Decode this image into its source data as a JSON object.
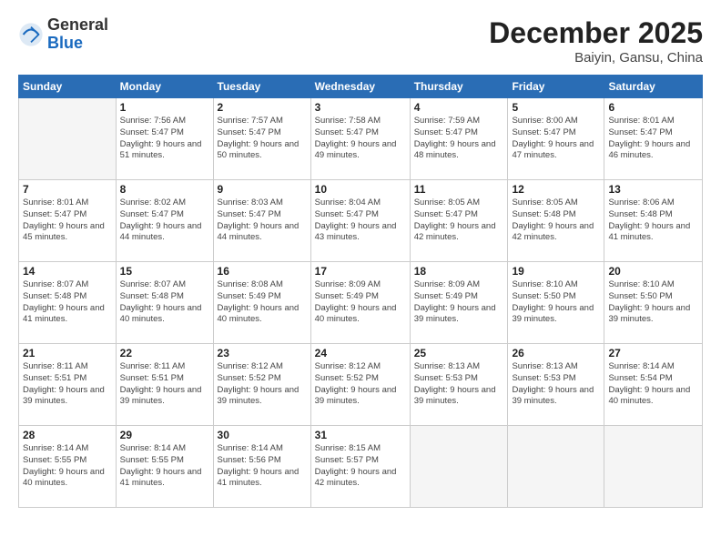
{
  "header": {
    "logo": {
      "general": "General",
      "blue": "Blue"
    },
    "title": "December 2025",
    "location": "Baiyin, Gansu, China"
  },
  "calendar": {
    "weekdays": [
      "Sunday",
      "Monday",
      "Tuesday",
      "Wednesday",
      "Thursday",
      "Friday",
      "Saturday"
    ],
    "weeks": [
      [
        {
          "day": null
        },
        {
          "day": 1,
          "sunrise": "7:56 AM",
          "sunset": "5:47 PM",
          "daylight": "9 hours and 51 minutes."
        },
        {
          "day": 2,
          "sunrise": "7:57 AM",
          "sunset": "5:47 PM",
          "daylight": "9 hours and 50 minutes."
        },
        {
          "day": 3,
          "sunrise": "7:58 AM",
          "sunset": "5:47 PM",
          "daylight": "9 hours and 49 minutes."
        },
        {
          "day": 4,
          "sunrise": "7:59 AM",
          "sunset": "5:47 PM",
          "daylight": "9 hours and 48 minutes."
        },
        {
          "day": 5,
          "sunrise": "8:00 AM",
          "sunset": "5:47 PM",
          "daylight": "9 hours and 47 minutes."
        },
        {
          "day": 6,
          "sunrise": "8:01 AM",
          "sunset": "5:47 PM",
          "daylight": "9 hours and 46 minutes."
        }
      ],
      [
        {
          "day": 7,
          "sunrise": "8:01 AM",
          "sunset": "5:47 PM",
          "daylight": "9 hours and 45 minutes."
        },
        {
          "day": 8,
          "sunrise": "8:02 AM",
          "sunset": "5:47 PM",
          "daylight": "9 hours and 44 minutes."
        },
        {
          "day": 9,
          "sunrise": "8:03 AM",
          "sunset": "5:47 PM",
          "daylight": "9 hours and 44 minutes."
        },
        {
          "day": 10,
          "sunrise": "8:04 AM",
          "sunset": "5:47 PM",
          "daylight": "9 hours and 43 minutes."
        },
        {
          "day": 11,
          "sunrise": "8:05 AM",
          "sunset": "5:47 PM",
          "daylight": "9 hours and 42 minutes."
        },
        {
          "day": 12,
          "sunrise": "8:05 AM",
          "sunset": "5:48 PM",
          "daylight": "9 hours and 42 minutes."
        },
        {
          "day": 13,
          "sunrise": "8:06 AM",
          "sunset": "5:48 PM",
          "daylight": "9 hours and 41 minutes."
        }
      ],
      [
        {
          "day": 14,
          "sunrise": "8:07 AM",
          "sunset": "5:48 PM",
          "daylight": "9 hours and 41 minutes."
        },
        {
          "day": 15,
          "sunrise": "8:07 AM",
          "sunset": "5:48 PM",
          "daylight": "9 hours and 40 minutes."
        },
        {
          "day": 16,
          "sunrise": "8:08 AM",
          "sunset": "5:49 PM",
          "daylight": "9 hours and 40 minutes."
        },
        {
          "day": 17,
          "sunrise": "8:09 AM",
          "sunset": "5:49 PM",
          "daylight": "9 hours and 40 minutes."
        },
        {
          "day": 18,
          "sunrise": "8:09 AM",
          "sunset": "5:49 PM",
          "daylight": "9 hours and 39 minutes."
        },
        {
          "day": 19,
          "sunrise": "8:10 AM",
          "sunset": "5:50 PM",
          "daylight": "9 hours and 39 minutes."
        },
        {
          "day": 20,
          "sunrise": "8:10 AM",
          "sunset": "5:50 PM",
          "daylight": "9 hours and 39 minutes."
        }
      ],
      [
        {
          "day": 21,
          "sunrise": "8:11 AM",
          "sunset": "5:51 PM",
          "daylight": "9 hours and 39 minutes."
        },
        {
          "day": 22,
          "sunrise": "8:11 AM",
          "sunset": "5:51 PM",
          "daylight": "9 hours and 39 minutes."
        },
        {
          "day": 23,
          "sunrise": "8:12 AM",
          "sunset": "5:52 PM",
          "daylight": "9 hours and 39 minutes."
        },
        {
          "day": 24,
          "sunrise": "8:12 AM",
          "sunset": "5:52 PM",
          "daylight": "9 hours and 39 minutes."
        },
        {
          "day": 25,
          "sunrise": "8:13 AM",
          "sunset": "5:53 PM",
          "daylight": "9 hours and 39 minutes."
        },
        {
          "day": 26,
          "sunrise": "8:13 AM",
          "sunset": "5:53 PM",
          "daylight": "9 hours and 39 minutes."
        },
        {
          "day": 27,
          "sunrise": "8:14 AM",
          "sunset": "5:54 PM",
          "daylight": "9 hours and 40 minutes."
        }
      ],
      [
        {
          "day": 28,
          "sunrise": "8:14 AM",
          "sunset": "5:55 PM",
          "daylight": "9 hours and 40 minutes."
        },
        {
          "day": 29,
          "sunrise": "8:14 AM",
          "sunset": "5:55 PM",
          "daylight": "9 hours and 41 minutes."
        },
        {
          "day": 30,
          "sunrise": "8:14 AM",
          "sunset": "5:56 PM",
          "daylight": "9 hours and 41 minutes."
        },
        {
          "day": 31,
          "sunrise": "8:15 AM",
          "sunset": "5:57 PM",
          "daylight": "9 hours and 42 minutes."
        },
        {
          "day": null
        },
        {
          "day": null
        },
        {
          "day": null
        }
      ]
    ]
  }
}
